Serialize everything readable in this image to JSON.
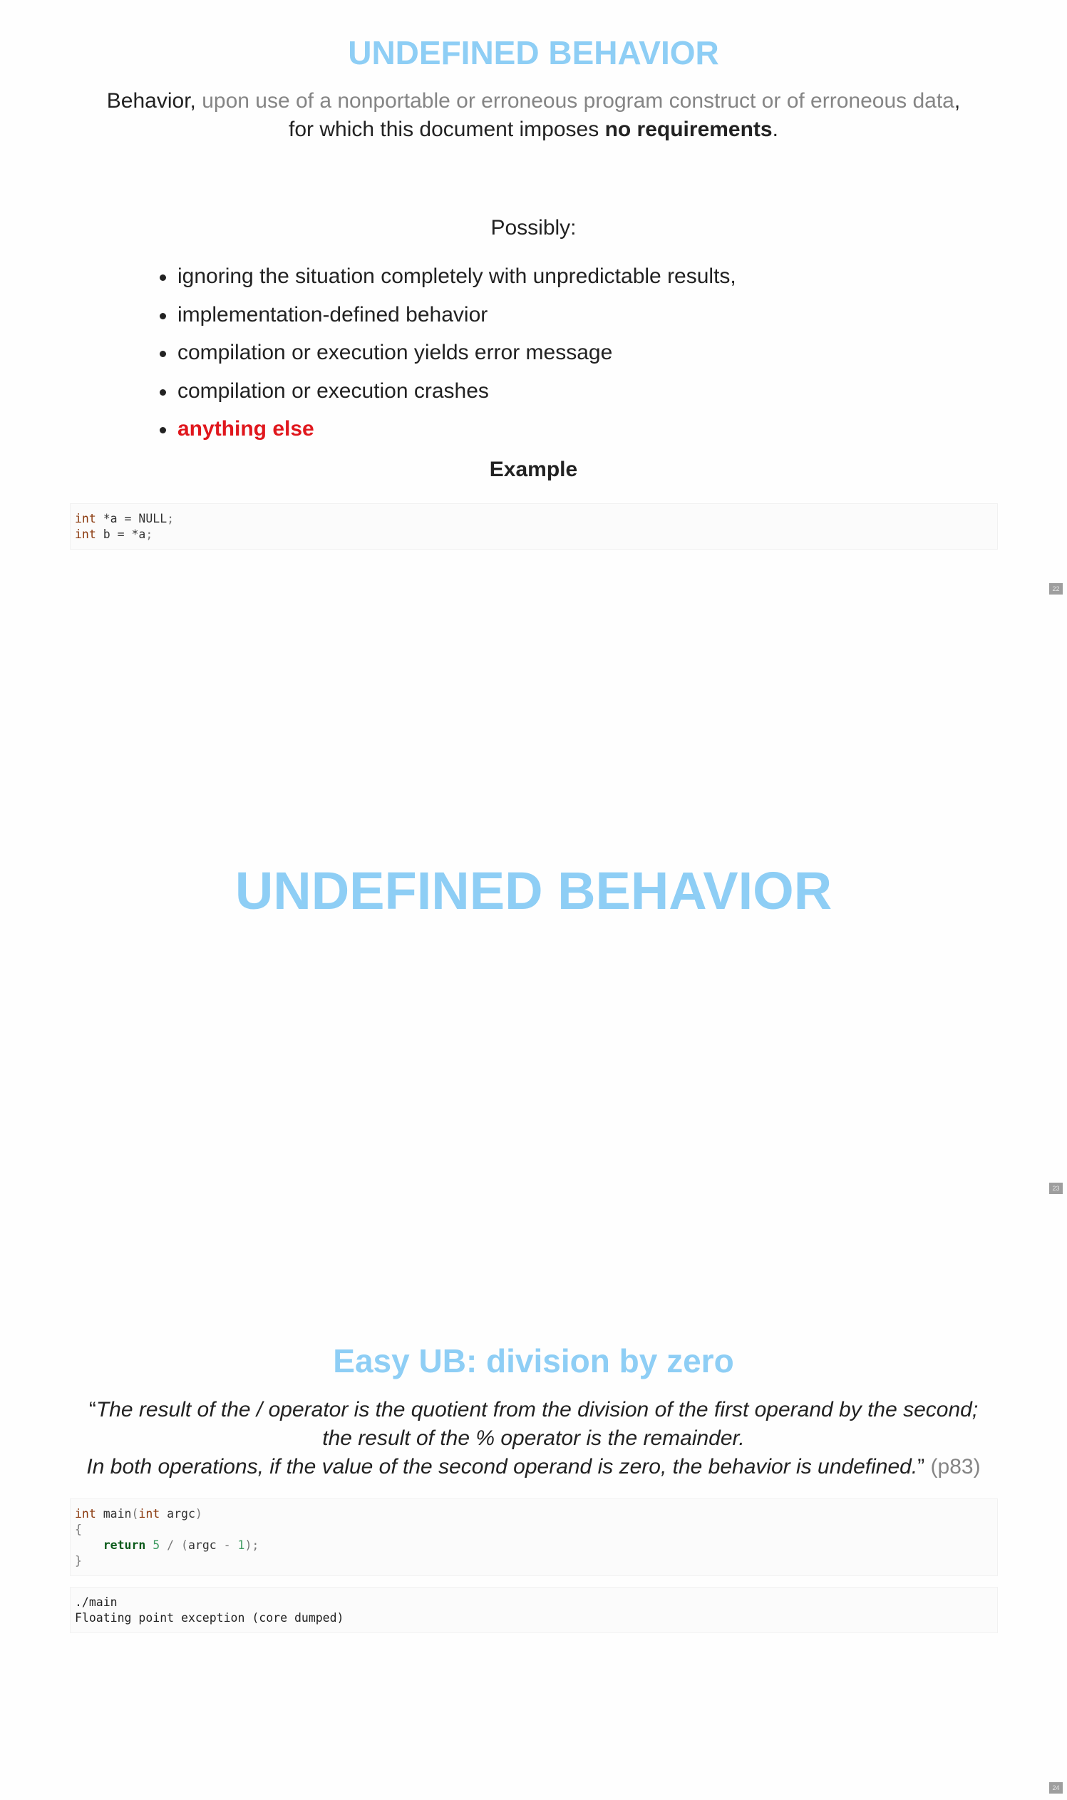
{
  "slide1": {
    "title": "UNDEFINED BEHAVIOR",
    "definition": {
      "prefix": "Behavior, ",
      "gray_part": "upon use of a nonportable or erroneous program construct or of erroneous data",
      "comma": ",",
      "line2_start": "for which this document imposes ",
      "bold_part": "no requirements",
      "end": "."
    },
    "possibly_label": "Possibly:",
    "bullets": [
      "ignoring the situation completely with unpredictable results,",
      "implementation-defined behavior",
      "compilation or execution yields error message",
      "compilation or execution crashes",
      "anything else"
    ],
    "example_label": "Example",
    "code": {
      "line1": {
        "type": "int",
        "rest": " *a = NULL",
        "semi": ";"
      },
      "line2": {
        "type": "int",
        "rest": " b = *a",
        "semi": ";"
      }
    },
    "page_number": "22"
  },
  "slide2": {
    "title": "UNDEFINED BEHAVIOR",
    "page_number": "23"
  },
  "slide3": {
    "title": "Easy UB: division by zero",
    "quote": {
      "open": "“",
      "line1": "The result of the  / operator is the quotient from the division of the first operand by the second;",
      "line2": "the result of the % operator is the remainder.",
      "line3": "In both operations, if the value of the second operand is zero, the behavior is undefined.",
      "close": "”",
      "citation": "(p83)"
    },
    "code": {
      "line1_type": "int",
      "line1_name": " main",
      "line1_paren_open": "(",
      "line1_arg_type": "int",
      "line1_arg": " argc",
      "line1_paren_close": ")",
      "line2": "{",
      "line3_indent": "    ",
      "line3_kw": "return",
      "line3_num1": " 5",
      "line3_op": " / ",
      "line3_paren_open": "(",
      "line3_var": "argc",
      "line3_minus": " - ",
      "line3_num2": "1",
      "line3_end": ");",
      "line4": "}"
    },
    "output": {
      "line1": "./main",
      "line2": "Floating point exception (core dumped)"
    },
    "page_number": "24"
  }
}
